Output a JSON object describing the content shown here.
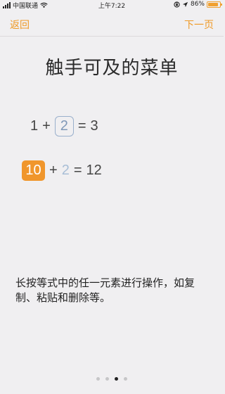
{
  "status_bar": {
    "carrier": "中国联通",
    "time": "上午7:22",
    "battery": "86%",
    "battery_level": 0.86
  },
  "nav": {
    "back_label": "返回",
    "next_label": "下一页"
  },
  "title": "触手可及的菜单",
  "equations": {
    "eq1": {
      "a": "1",
      "op": "+",
      "b": "2",
      "eq": "=",
      "result": "3"
    },
    "eq2": {
      "a": "10",
      "op": "+",
      "b": "2",
      "eq": "=",
      "result": "12"
    }
  },
  "description": "长按等式中的任一元素进行操作，如复制、粘贴和删除等。",
  "pagination": {
    "total": 4,
    "current": 3
  },
  "colors": {
    "accent": "#ef9a26",
    "highlight": "#f0962c",
    "boxed_border": "#9ab0cc",
    "background": "#f0eff1"
  },
  "icons": [
    "signal-icon",
    "wifi-icon",
    "lock-rotation-icon",
    "location-arrow-icon",
    "battery-icon"
  ]
}
